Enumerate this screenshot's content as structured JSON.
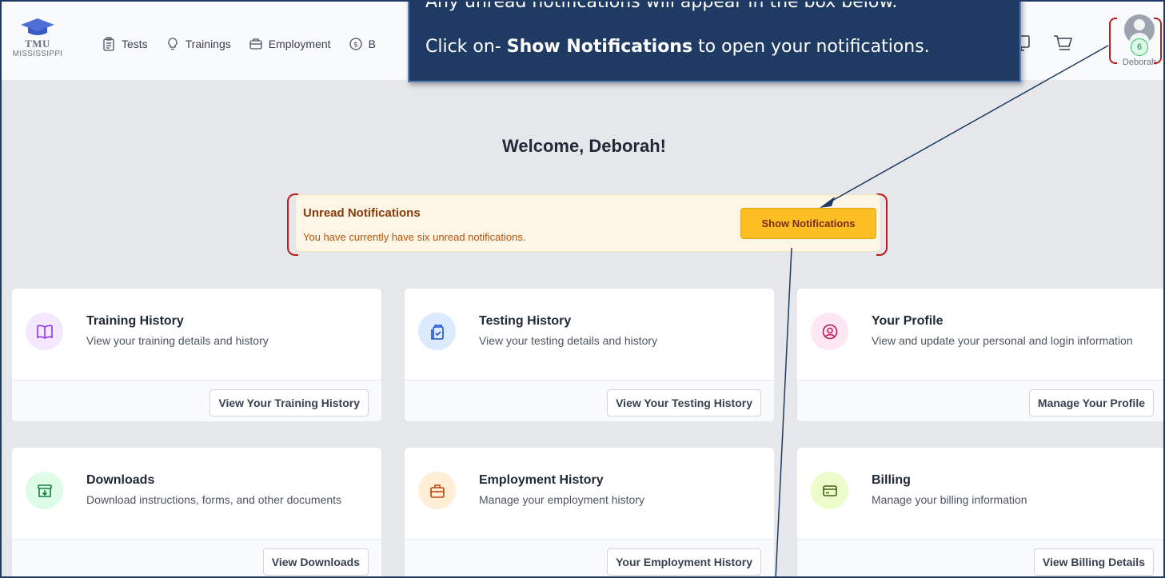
{
  "brand": {
    "line1": "TMU",
    "line2": "MISSISSIPPI"
  },
  "nav": [
    {
      "label": "Tests",
      "icon": "clipboard-icon"
    },
    {
      "label": "Trainings",
      "icon": "lightbulb-icon"
    },
    {
      "label": "Employment",
      "icon": "briefcase-icon"
    },
    {
      "label": "B",
      "icon": "dollar-circle-icon"
    }
  ],
  "user": {
    "name": "Deborah",
    "badge_count": "6"
  },
  "callout": {
    "line1": "Any unread notifications will appear in the box below.",
    "line2_prefix": "Click on- ",
    "line2_bold": "Show Notifications",
    "line2_suffix": " to open your notifications."
  },
  "welcome": "Welcome, Deborah!",
  "notice": {
    "title": "Unread Notifications",
    "message": "You have currently have six unread notifications.",
    "button": "Show Notifications"
  },
  "cards": [
    {
      "title": "Training History",
      "desc": "View your training details and history",
      "button": "View Your Training History",
      "icon": "book-icon",
      "color": "#f3e8ff",
      "icon_color": "#9333ea"
    },
    {
      "title": "Testing History",
      "desc": "View your testing details and history",
      "button": "View Your Testing History",
      "icon": "clipboard-check-icon",
      "color": "#dbeafe",
      "icon_color": "#1d4ed8"
    },
    {
      "title": "Your Profile",
      "desc": "View and update your personal and login information",
      "button": "Manage Your Profile",
      "icon": "user-circle-icon",
      "color": "#fce7f3",
      "icon_color": "#be185d"
    },
    {
      "title": "Downloads",
      "desc": "Download instructions, forms, and other documents",
      "button": "View Downloads",
      "icon": "archive-download-icon",
      "color": "#dcfce7",
      "icon_color": "#15803d"
    },
    {
      "title": "Employment History",
      "desc": "Manage your employment history",
      "button": "Your Employment History",
      "icon": "briefcase-icon",
      "color": "#ffedd5",
      "icon_color": "#c2410c"
    },
    {
      "title": "Billing",
      "desc": "Manage your billing information",
      "button": "View Billing Details",
      "icon": "credit-card-icon",
      "color": "#ecfccb",
      "icon_color": "#3f6212"
    }
  ],
  "colors": {
    "frame": "#1f3b63",
    "callout_bg": "#1f3b63",
    "accent_button": "#fbbf24",
    "highlight_bracket": "#b91c1c"
  }
}
